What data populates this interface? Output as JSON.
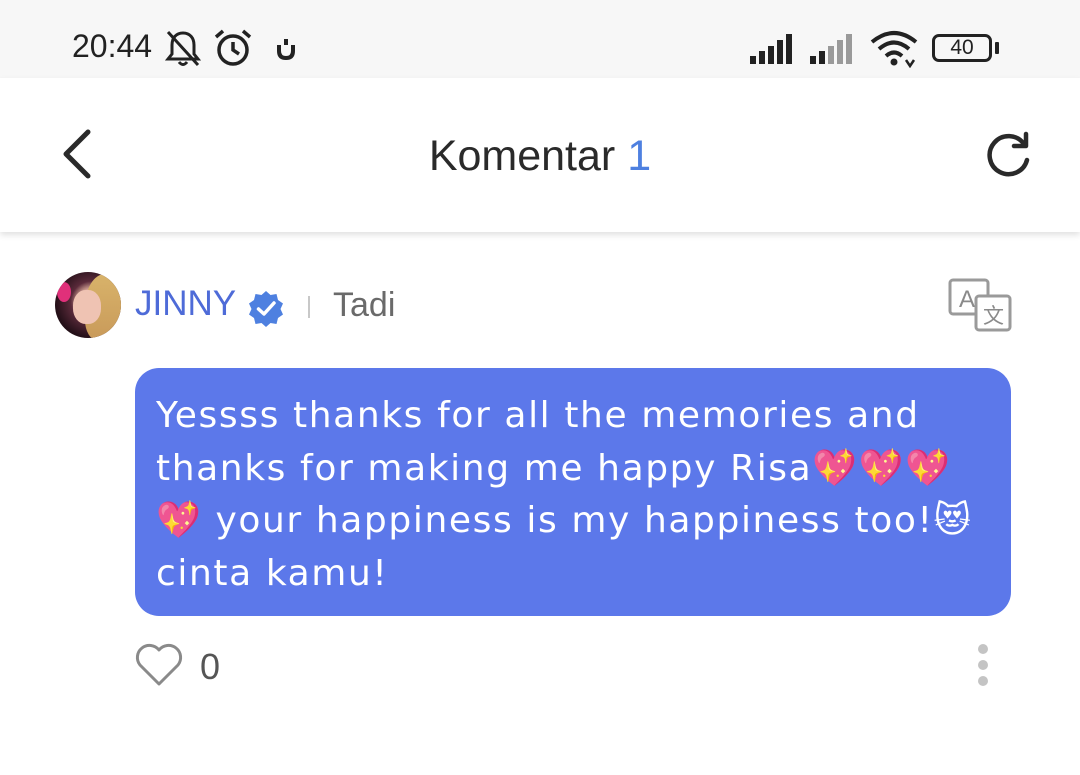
{
  "status_bar": {
    "time": "20:44",
    "battery": "40",
    "icons": [
      "bell-off-icon",
      "alarm-icon",
      "app-notification-icon",
      "signal-icon",
      "signal-weak-icon",
      "wifi-icon",
      "battery-icon"
    ]
  },
  "header": {
    "title": "Komentar",
    "count": "1",
    "back_icon": "chevron-left-icon",
    "refresh_icon": "refresh-icon"
  },
  "comment": {
    "username": "JINNY",
    "verified_icon": "verified-badge-icon",
    "time": "Tadi",
    "translate_icon": "translate-icon",
    "text": "Yessss thanks for all the memories and\nthanks for making me happy Risa💖💖💖\n💖 your happiness is my happiness too!😻\ncinta kamu!",
    "likes": "0",
    "like_icon": "heart-icon",
    "more_icon": "more-vertical-icon"
  },
  "colors": {
    "bubble": "#5c78ea",
    "username": "#4e6bd8",
    "count_accent": "#4e80e0"
  }
}
